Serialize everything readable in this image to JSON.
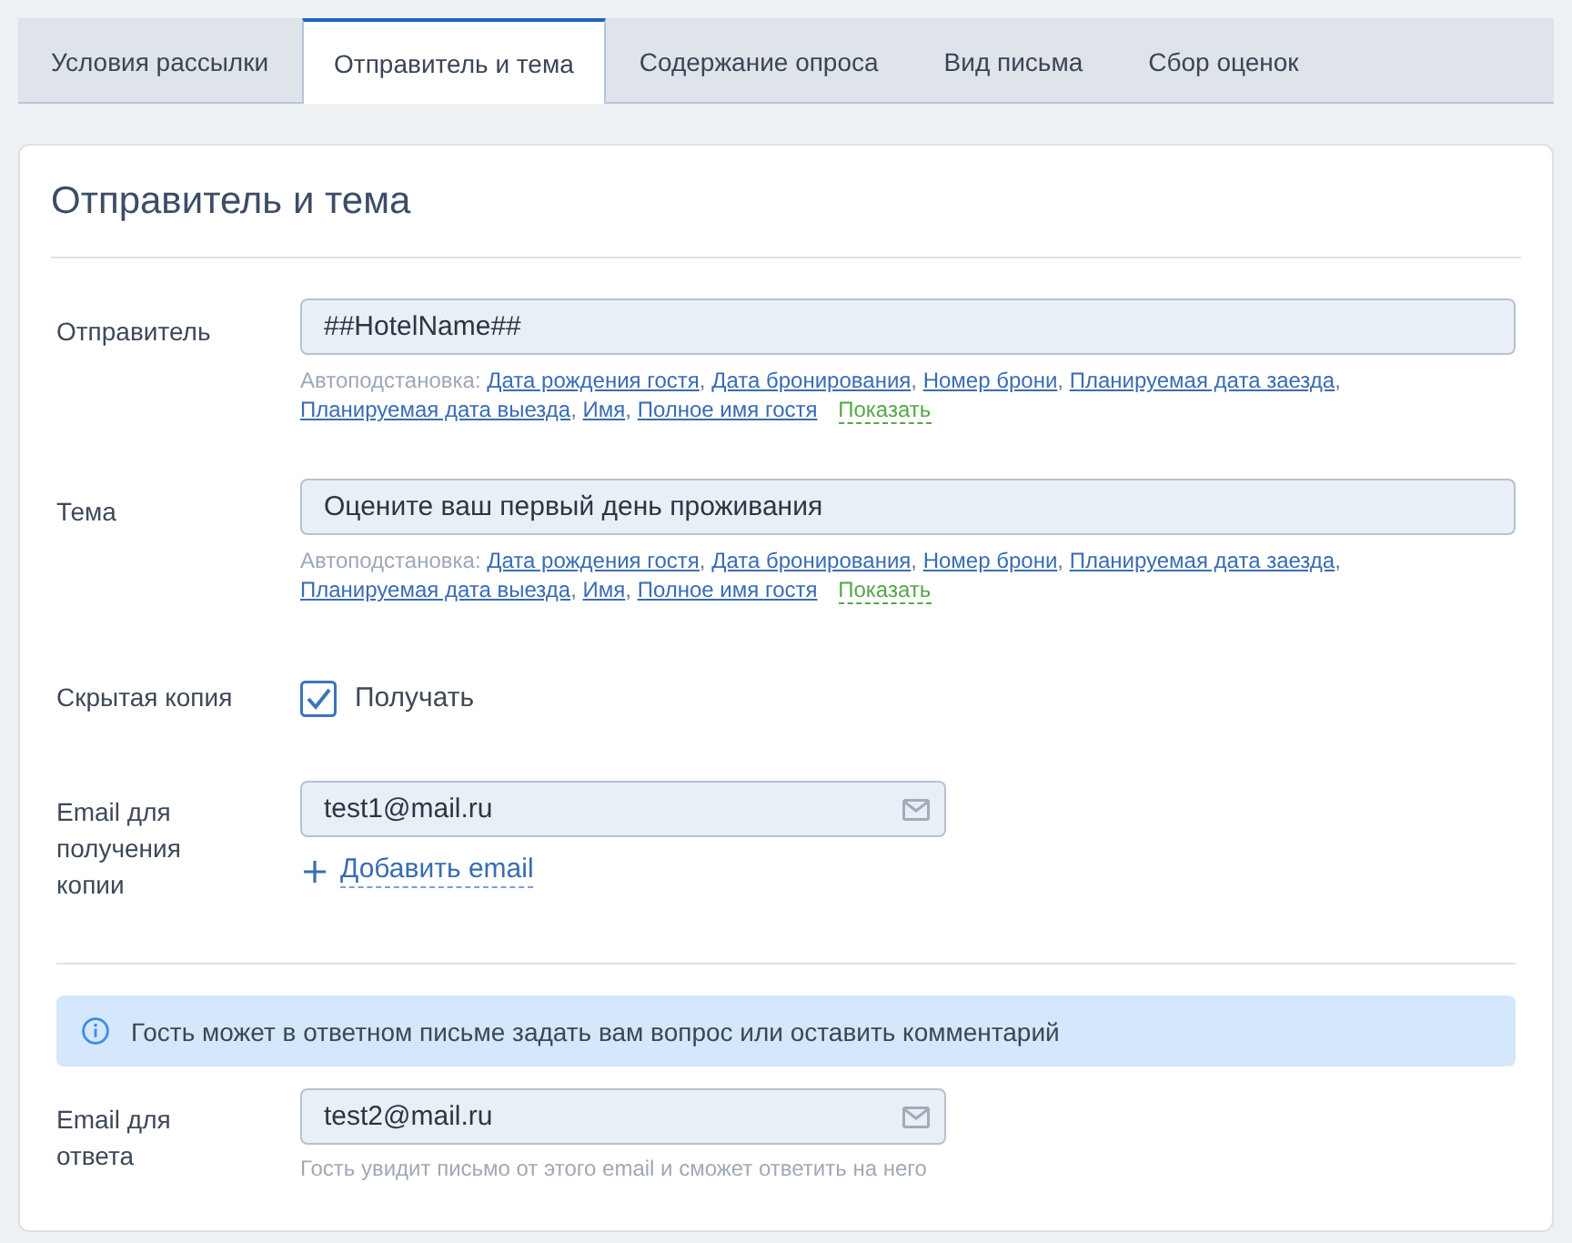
{
  "tabs": [
    {
      "label": "Условия рассылки",
      "selected": false
    },
    {
      "label": "Отправитель и тема",
      "selected": true
    },
    {
      "label": "Содержание опроса",
      "selected": false
    },
    {
      "label": "Вид письма",
      "selected": false
    },
    {
      "label": "Сбор оценок",
      "selected": false
    }
  ],
  "section": {
    "title": "Отправитель и тема"
  },
  "fields": [
    {
      "kind": "text",
      "label": "Отправитель",
      "value": "##HotelName##",
      "autofill": {
        "label": "Автоподстановка:",
        "separator": ",",
        "links": [
          "Дата рождения гостя",
          "Дата бронирования",
          "Номер брони",
          "Планируемая дата заезда",
          "Планируемая дата выезда",
          "Имя",
          "Полное имя гостя"
        ],
        "toggle": "Показать"
      }
    },
    {
      "kind": "text",
      "label": "Тема",
      "value": "Оцените ваш первый день проживания",
      "autofill": {
        "label": "Автоподстановка:",
        "separator": ",",
        "links": [
          "Дата рождения гостя",
          "Дата бронирования",
          "Номер брони",
          "Планируемая дата заезда",
          "Планируемая дата выезда",
          "Имя",
          "Полное имя гостя"
        ],
        "toggle": "Показать"
      }
    },
    {
      "kind": "checkbox",
      "label": "Скрытая копия",
      "option": "Получать",
      "checked": true
    },
    {
      "kind": "email",
      "label": "Email для получения копии",
      "value": "test1@mail.ru",
      "add_link": "Добавить email"
    }
  ],
  "notice": {
    "text": "Гость может в ответном письме задать вам вопрос или оставить комментарий"
  },
  "reply_fields": [
    {
      "kind": "email",
      "label": "Email для ответа",
      "value": "test2@mail.ru",
      "hint": "Гость увидит письмо от этого email и сможет ответить на него"
    }
  ]
}
